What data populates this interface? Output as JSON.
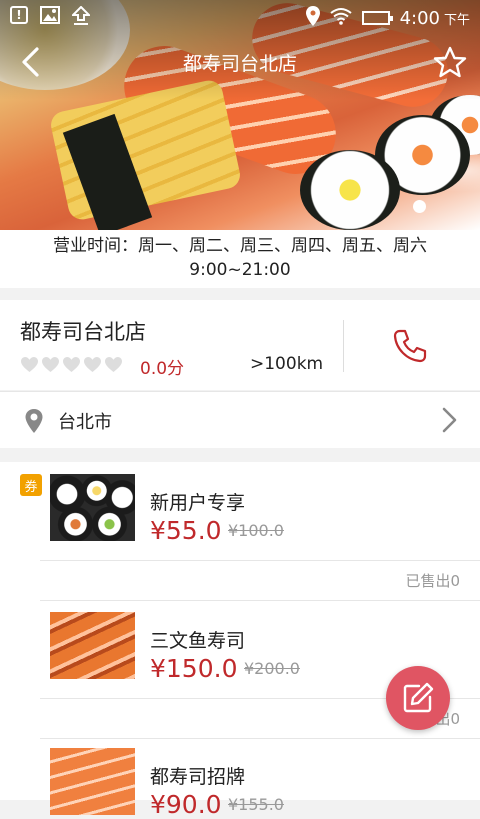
{
  "status_bar": {
    "time": "4:00",
    "period": "下午",
    "icons": [
      "notification-icon",
      "image-icon",
      "upload-icon",
      "location-icon",
      "wifi-icon",
      "battery-icon"
    ]
  },
  "nav": {
    "title": "都寿司台北店",
    "back_icon": "chevron-left-icon",
    "favorite_icon": "star-outline-icon"
  },
  "hero": {
    "carousel_dots": 1,
    "active_dot": 1
  },
  "hours": {
    "days": "营业时间：周一、周二、周三、周四、周五、周六",
    "time": "9:00~21:00"
  },
  "shop": {
    "name": "都寿司台北店",
    "rating_hearts": 5,
    "rating_filled": 0,
    "score": "0.0分",
    "distance": ">100km",
    "phone_icon": "phone-icon"
  },
  "address": {
    "city": "台北市",
    "pin_icon": "location-pin-icon",
    "chevron_icon": "chevron-right-icon"
  },
  "list": {
    "coupon_badge": "券",
    "items": [
      {
        "name": "新用户专享",
        "price": "¥55.0",
        "original_price": "¥100.0",
        "sold": "已售出0"
      },
      {
        "name": "三文鱼寿司",
        "price": "¥150.0",
        "original_price": "¥200.0",
        "sold": "已售出0"
      },
      {
        "name": "都寿司招牌",
        "price": "¥90.0",
        "original_price": "¥155.0",
        "sold": ""
      }
    ]
  },
  "fab": {
    "icon": "edit-icon"
  },
  "colors": {
    "accent_red": "#c0292b",
    "fab_red": "#e05563",
    "badge_orange": "#f2a100"
  }
}
